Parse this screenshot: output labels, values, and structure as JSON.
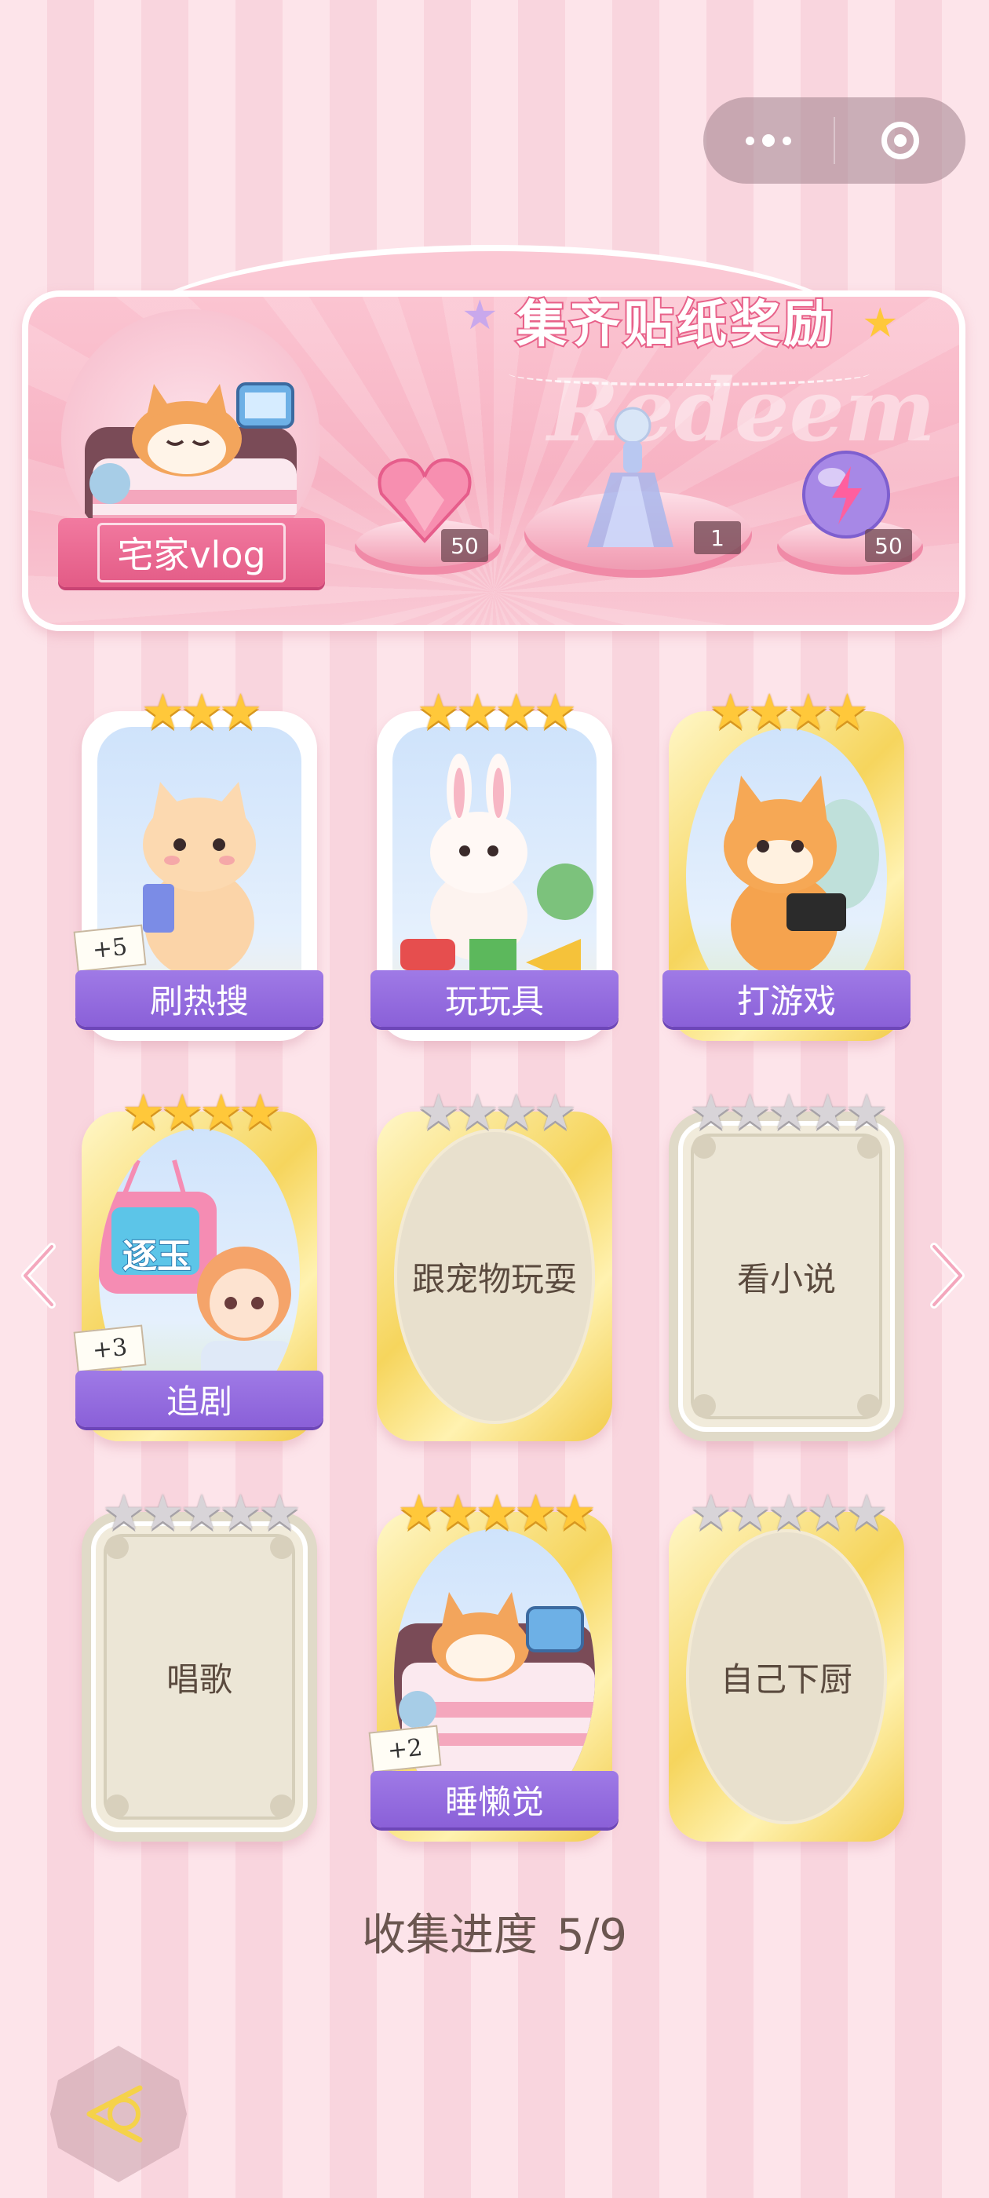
{
  "capsule": {
    "more_icon": "more-dots-icon",
    "close_icon": "target-ring-icon"
  },
  "banner": {
    "title": "集齐贴纸奖励",
    "watermark": "Redeem",
    "current_item_label": "宅家vlog",
    "rewards": [
      {
        "icon": "pink-heart-gem-icon",
        "count": "50"
      },
      {
        "icon": "fairy-outfit-icon",
        "count": "1"
      },
      {
        "icon": "purple-lightning-orb-icon",
        "count": "50"
      }
    ]
  },
  "cards": [
    {
      "label": "刷热搜",
      "stars": 3,
      "max_stars": 3,
      "collected": true,
      "bonus": "+5",
      "art": "cat-with-phone"
    },
    {
      "label": "玩玩具",
      "stars": 4,
      "max_stars": 4,
      "collected": true,
      "bonus": "",
      "art": "bunny-with-toys"
    },
    {
      "label": "打游戏",
      "stars": 4,
      "max_stars": 4,
      "collected": true,
      "bonus": "",
      "art": "cat-with-switch"
    },
    {
      "label": "追剧",
      "stars": 4,
      "max_stars": 4,
      "collected": true,
      "bonus": "+3",
      "art": "girl-with-tv",
      "tv_text": "逐玉"
    },
    {
      "label": "跟宠物玩耍",
      "stars": 0,
      "max_stars": 4,
      "collected": false
    },
    {
      "label": "看小说",
      "stars": 0,
      "max_stars": 5,
      "collected": false
    },
    {
      "label": "唱歌",
      "stars": 0,
      "max_stars": 5,
      "collected": false
    },
    {
      "label": "睡懒觉",
      "stars": 5,
      "max_stars": 5,
      "collected": true,
      "bonus": "+2",
      "art": "corgi-sleeping"
    },
    {
      "label": "自己下厨",
      "stars": 0,
      "max_stars": 5,
      "collected": false
    }
  ],
  "progress": {
    "label": "收集进度",
    "value": "5/9",
    "collected": 5,
    "total": 9
  },
  "nav": {
    "prev_icon": "chevron-left-icon",
    "next_icon": "chevron-right-icon",
    "back_icon": "back-triangle-icon"
  },
  "colors": {
    "accent_purple": "#8a60d8",
    "pink": "#e35b86",
    "gold_star": "#ffc83a",
    "gray_star": "#d8d4d8"
  }
}
